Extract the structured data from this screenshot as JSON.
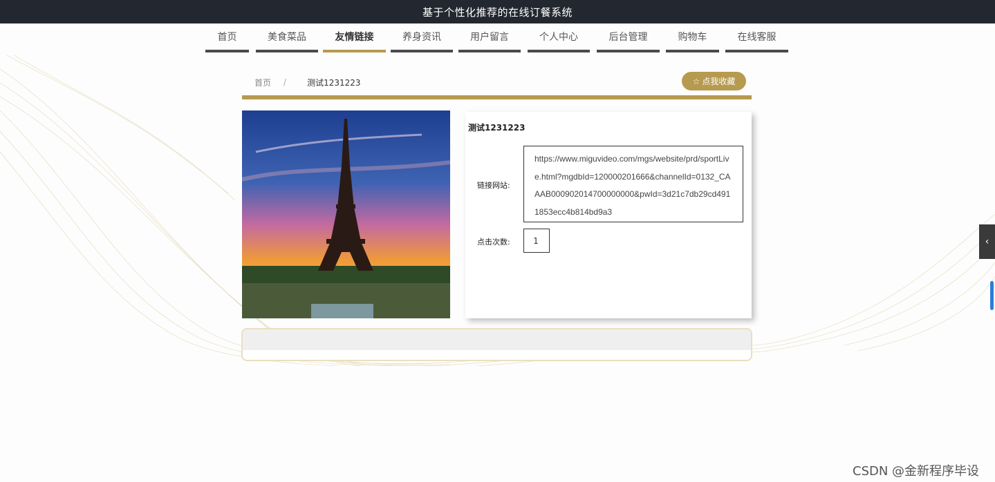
{
  "header": {
    "title": "基于个性化推荐的在线订餐系统"
  },
  "nav": {
    "items": [
      {
        "label": "首页"
      },
      {
        "label": "美食菜品"
      },
      {
        "label": "友情链接"
      },
      {
        "label": "养身资讯"
      },
      {
        "label": "用户留言"
      },
      {
        "label": "个人中心"
      },
      {
        "label": "后台管理"
      },
      {
        "label": "购物车"
      },
      {
        "label": "在线客服"
      }
    ],
    "active": "友情链接"
  },
  "breadcrumb": {
    "home": "首页",
    "separator": "/",
    "current": "测试1231223"
  },
  "favorite_button": {
    "icon": "star-outline-icon",
    "label": "点我收藏"
  },
  "detail": {
    "title": "测试1231223",
    "image": "eiffel-tower-sunset",
    "link_label": "链接网站:",
    "link_value": "https://www.miguvideo.com/mgs/website/prd/sportLive.html?mgdbId=120000201666&channelId=0132_CAAAB000902014700000000&pwId=3d21c7db29cd4911853ecc4b814bd9a3",
    "clicks_label": "点击次数:",
    "clicks_value": "1"
  },
  "side_toggle": {
    "icon": "chevron-left-icon",
    "glyph": "‹"
  },
  "watermark": "CSDN @金新程序毕设",
  "colors": {
    "accent": "#b69a4f",
    "topbar": "#232830",
    "nav_underline": "#4a4a4a"
  }
}
